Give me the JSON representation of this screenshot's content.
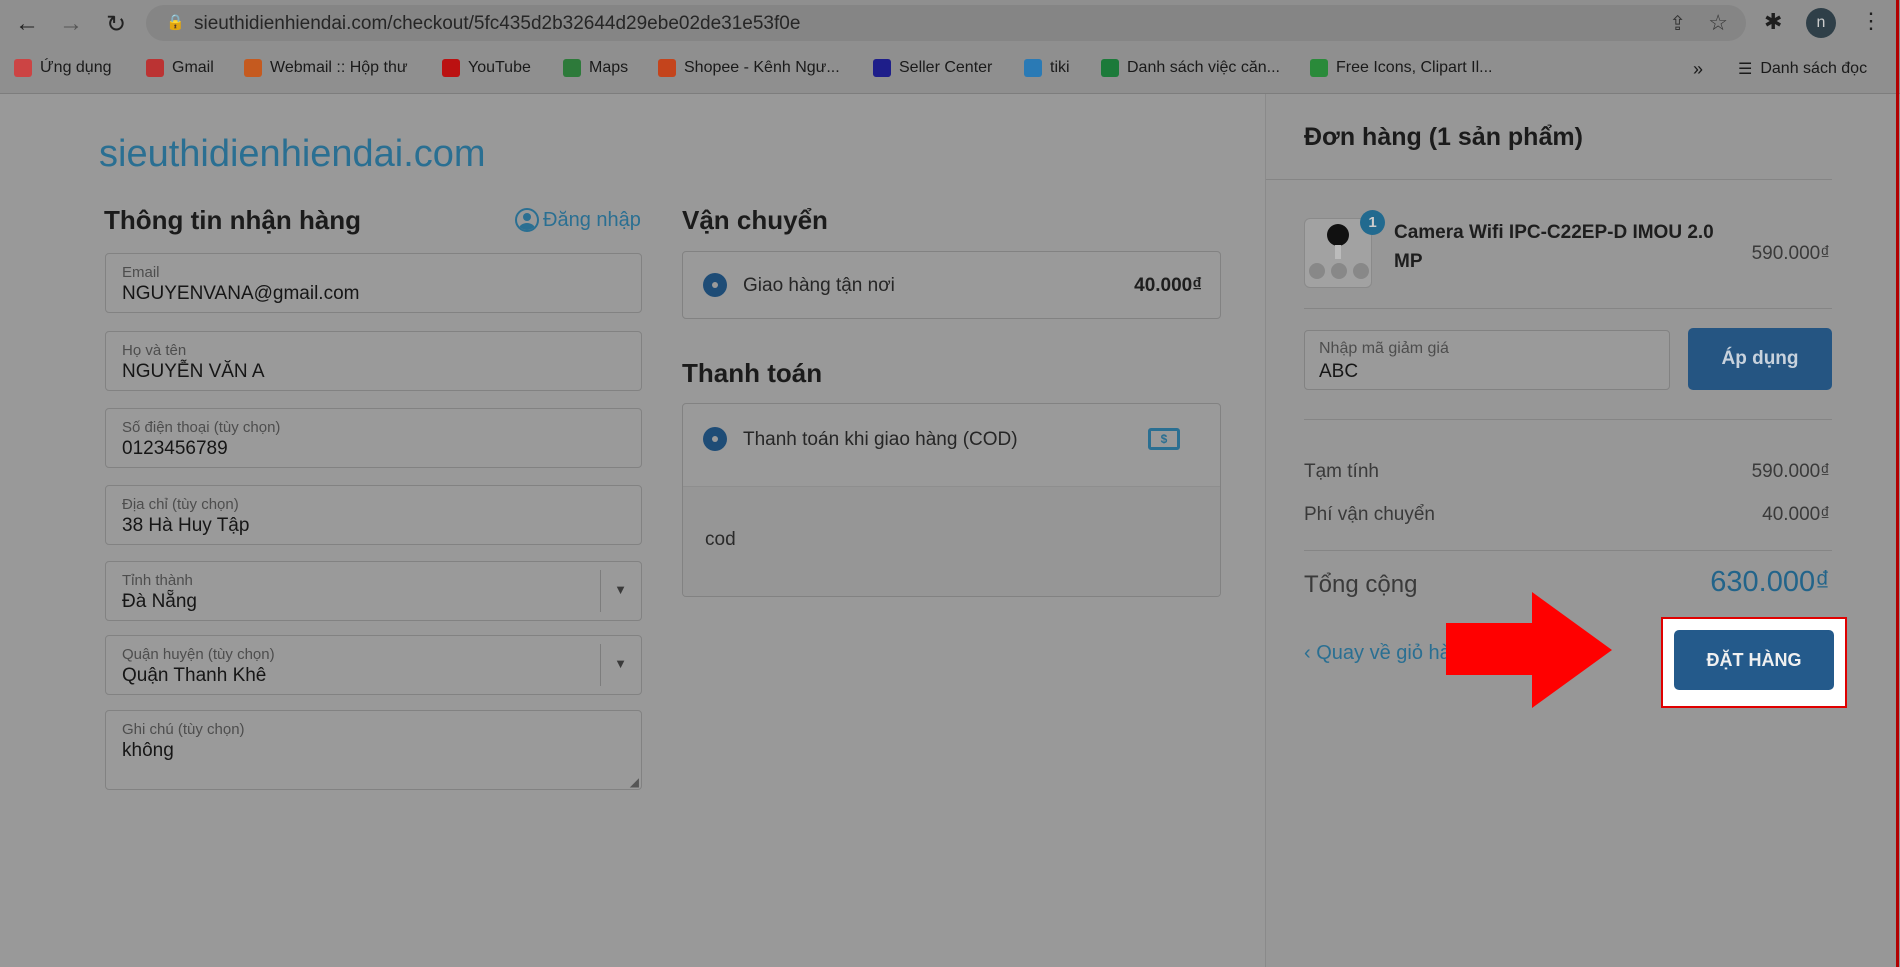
{
  "browser": {
    "url": "sieuthidienhiendai.com/checkout/5fc435d2b32644d29ebe02de31e53f0e",
    "profile_initial": "n",
    "bookmarks": [
      {
        "label": "Ứng dụng",
        "color": "#c44"
      },
      {
        "label": "Gmail",
        "color": "#b33"
      },
      {
        "label": "Webmail :: Hộp thư",
        "color": "#c55a1f"
      },
      {
        "label": "YouTube",
        "color": "#b11"
      },
      {
        "label": "Maps",
        "color": "#2d7a3a"
      },
      {
        "label": "Shopee - Kênh Ngư...",
        "color": "#c4441c"
      },
      {
        "label": "Seller Center",
        "color": "#1e1e8a"
      },
      {
        "label": "tiki",
        "color": "#2a7ab5"
      },
      {
        "label": "Danh sách việc căn...",
        "color": "#1c7a3a"
      },
      {
        "label": "Free Icons, Clipart Il...",
        "color": "#2a8a3a"
      }
    ],
    "overflow": "»",
    "reading_list": "Danh sách đọc"
  },
  "logo": "sieuthidienhiendai.com",
  "shipping_info": {
    "title": "Thông tin nhận hàng",
    "login": "Đăng nhập",
    "fields": [
      {
        "label": "Email",
        "value": "NGUYENVANA@gmail.com"
      },
      {
        "label": "Họ và tên",
        "value": "NGUYỄN VĂN A"
      },
      {
        "label": "Số điện thoại (tùy chọn)",
        "value": "0123456789"
      },
      {
        "label": "Địa chỉ (tùy chọn)",
        "value": "38 Hà Huy Tập"
      },
      {
        "label": "Tỉnh thành",
        "value": "Đà Nẵng"
      },
      {
        "label": "Quận huyện (tùy chọn)",
        "value": "Quận Thanh Khê"
      },
      {
        "label": "Ghi chú (tùy chọn)",
        "value": "không"
      }
    ]
  },
  "shipping": {
    "title": "Vận chuyển",
    "option": "Giao hàng tận nơi",
    "price": "40.000₫"
  },
  "payment": {
    "title": "Thanh toán",
    "option": "Thanh toán khi giao hàng (COD)",
    "description": "cod"
  },
  "order": {
    "title": "Đơn hàng (1 sản phẩm)",
    "item": {
      "qty": "1",
      "name_line1": "Camera Wifi IPC-C22EP-D IMOU 2.0",
      "name_line2": "MP",
      "price": "590.000₫"
    },
    "discount": {
      "label": "Nhập mã giảm giá",
      "value": "ABC",
      "apply": "Áp dụng"
    },
    "subtotal_label": "Tạm tính",
    "subtotal": "590.000₫",
    "ship_label": "Phí vận chuyển",
    "ship": "40.000₫",
    "total_label": "Tổng cộng",
    "total": "630.000₫",
    "back": "‹ Quay về giỏ hàng",
    "submit": "ĐẶT HÀNG"
  },
  "colors": {
    "accent": "#255582",
    "link": "#2a6f92",
    "arrow": "#ff0000"
  }
}
